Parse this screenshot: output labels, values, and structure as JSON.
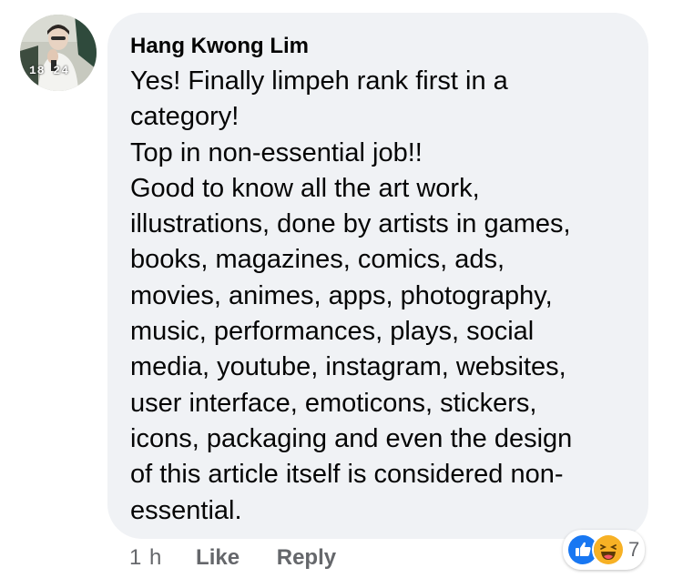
{
  "comment": {
    "author": "Hang Kwong Lim",
    "avatar_badge": "18 24",
    "lines": [
      "Yes! Finally limpeh rank first in a",
      "category!",
      "Top in non-essential job!!",
      "Good to know all the art work,",
      "illustrations, done by artists in games,",
      "books, magazines, comics, ads,",
      "movies, animes, apps, photography,",
      "music, performances, plays, social",
      "media, youtube, instagram, websites,",
      "user interface, emoticons, stickers,",
      "icons, packaging and even the design",
      "of this article itself is considered non-",
      "essential."
    ]
  },
  "actions": {
    "time": "1 h",
    "like_label": "Like",
    "reply_label": "Reply"
  },
  "reactions": {
    "icons": [
      "like-icon",
      "haha-icon"
    ],
    "count": "7",
    "colors": {
      "like": "#1877f2",
      "haha": "#f7b125"
    }
  },
  "colors": {
    "bubble": "#f0f2f5",
    "text": "#050505",
    "secondary_text": "#65676b"
  }
}
